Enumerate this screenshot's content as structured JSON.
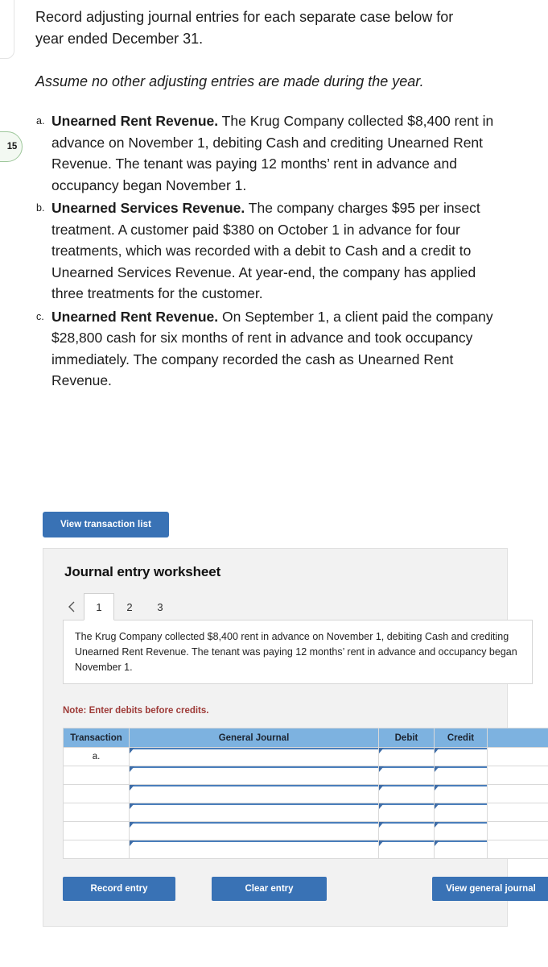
{
  "badge": {
    "label": "15"
  },
  "question": {
    "intro": "Record adjusting journal entries for each separate case below for year ended December 31.",
    "assume": "Assume no other adjusting entries are made during the year.",
    "cases": [
      {
        "marker": "a.",
        "title": "Unearned Rent Revenue.",
        "body": " The Krug Company collected $8,400 rent in advance on November 1, debiting Cash and crediting Unearned Rent Revenue. The tenant was paying 12 months’ rent in advance and occupancy began November 1."
      },
      {
        "marker": "b.",
        "title": "Unearned Services Revenue.",
        "body": " The company charges $95 per insect treatment. A customer paid $380 on October 1 in advance for four treatments, which was recorded with a debit to Cash and a credit to Unearned Services Revenue. At year-end, the company has applied three treatments for the customer."
      },
      {
        "marker": "c.",
        "title": "Unearned Rent Revenue.",
        "body": " On September 1, a client paid the company $28,800 cash for six months of rent in advance and took occupancy immediately. The company recorded the cash as Unearned Rent Revenue."
      }
    ]
  },
  "view_transaction_list_label": "View transaction list",
  "worksheet": {
    "title": "Journal entry worksheet",
    "prev_icon": "chevron-left-icon",
    "tabs": [
      {
        "label": "1",
        "active": true
      },
      {
        "label": "2",
        "active": false
      },
      {
        "label": "3",
        "active": false
      }
    ],
    "description": "The Krug Company collected $8,400 rent in advance on November 1, debiting Cash and crediting Unearned Rent Revenue. The tenant was paying 12 months’ rent in advance and occupancy began November 1.",
    "note": "Note: Enter debits before credits.",
    "table": {
      "headers": [
        "Transaction",
        "General Journal",
        "Debit",
        "Credit"
      ],
      "rows": [
        {
          "transaction": "a.",
          "general_journal": "",
          "debit": "",
          "credit": ""
        },
        {
          "transaction": "",
          "general_journal": "",
          "debit": "",
          "credit": ""
        },
        {
          "transaction": "",
          "general_journal": "",
          "debit": "",
          "credit": ""
        },
        {
          "transaction": "",
          "general_journal": "",
          "debit": "",
          "credit": ""
        },
        {
          "transaction": "",
          "general_journal": "",
          "debit": "",
          "credit": ""
        },
        {
          "transaction": "",
          "general_journal": "",
          "debit": "",
          "credit": ""
        }
      ]
    },
    "buttons": {
      "record": "Record entry",
      "clear": "Clear entry",
      "view_general_journal": "View general journal"
    }
  },
  "colors": {
    "button_blue": "#3972b5",
    "table_header_blue": "#7db2e0",
    "cell_border_blue": "#4a7ebb",
    "note_red": "#9e3b38",
    "panel_gray": "#f2f2f2",
    "badge_green": "#9ec79b"
  }
}
